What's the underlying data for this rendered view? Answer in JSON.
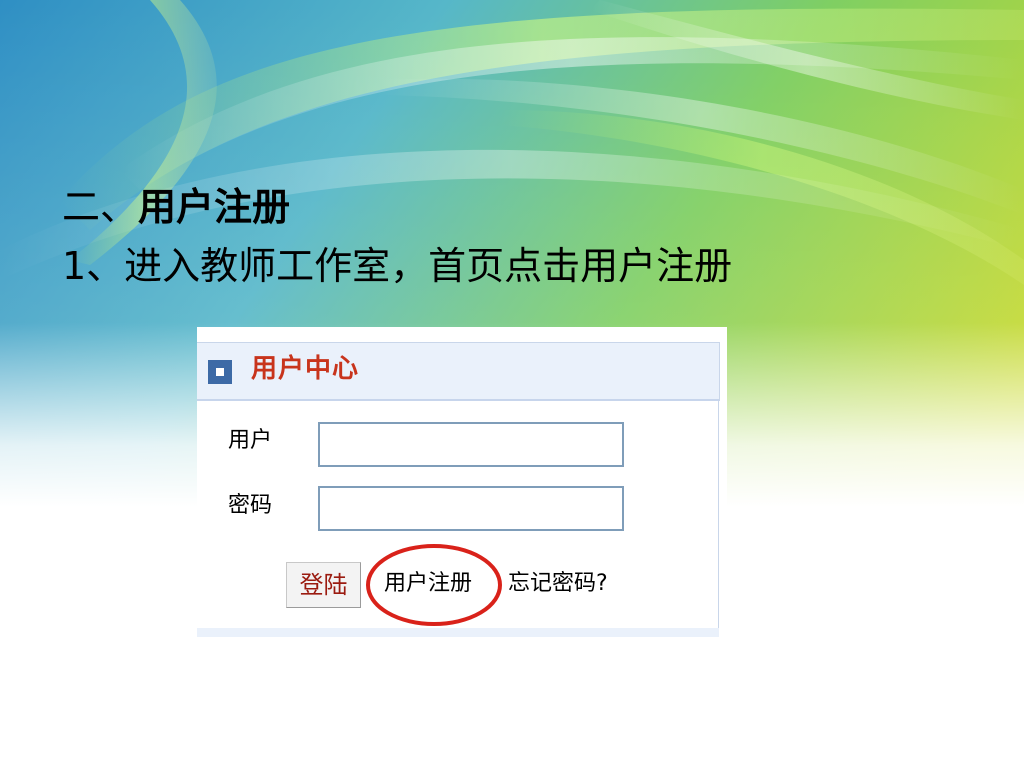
{
  "slide": {
    "heading_number": "二、",
    "heading_title": "用户注册",
    "step_text": "1、进入教师工作室，首页点击用户注册"
  },
  "widget": {
    "title": "用户中心",
    "user_label": "用户",
    "password_label": "密码",
    "user_value": "",
    "password_value": "",
    "login_button_label": "登陆",
    "register_link_label": "用户注册",
    "forgot_link_label": "忘记密码?"
  },
  "colors": {
    "widget_title": "#c8341c",
    "header_bg": "#eaf1fb",
    "header_icon": "#3d6aa6",
    "input_border": "#7f9db9",
    "login_text": "#9b1b10",
    "highlight_ellipse": "#d9221a"
  },
  "icons": {
    "header_icon": "square-bullet-icon"
  }
}
